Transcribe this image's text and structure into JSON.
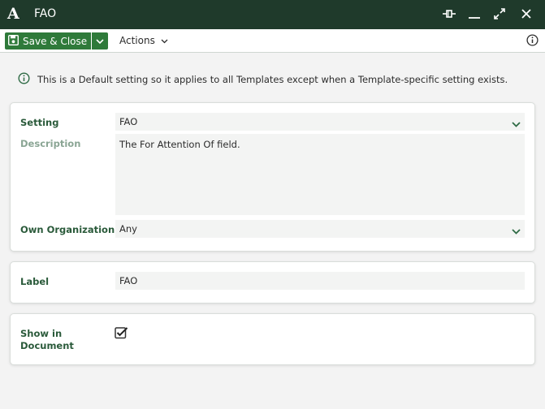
{
  "window": {
    "logo": "A",
    "title": "FAO"
  },
  "toolbar": {
    "save_label": "Save & Close",
    "actions_label": "Actions"
  },
  "info": {
    "text": "This is a Default setting so it applies to all Templates except when a Template-specific setting exists."
  },
  "form": {
    "setting": {
      "label": "Setting",
      "value": "FAO"
    },
    "description": {
      "label": "Description",
      "value": "The For Attention Of field."
    },
    "own_organization": {
      "label": "Own Organization",
      "value": "Any"
    },
    "label_field": {
      "label": "Label",
      "value": "FAO"
    },
    "show_in_document": {
      "label_line1": "Show in",
      "label_line2": "Document",
      "checked": true
    }
  },
  "colors": {
    "titlebar": "#1f3a2b",
    "primary_button": "#2f7a3a",
    "label_text": "#2a5a3a",
    "accent_chevron": "#2e6b45"
  }
}
